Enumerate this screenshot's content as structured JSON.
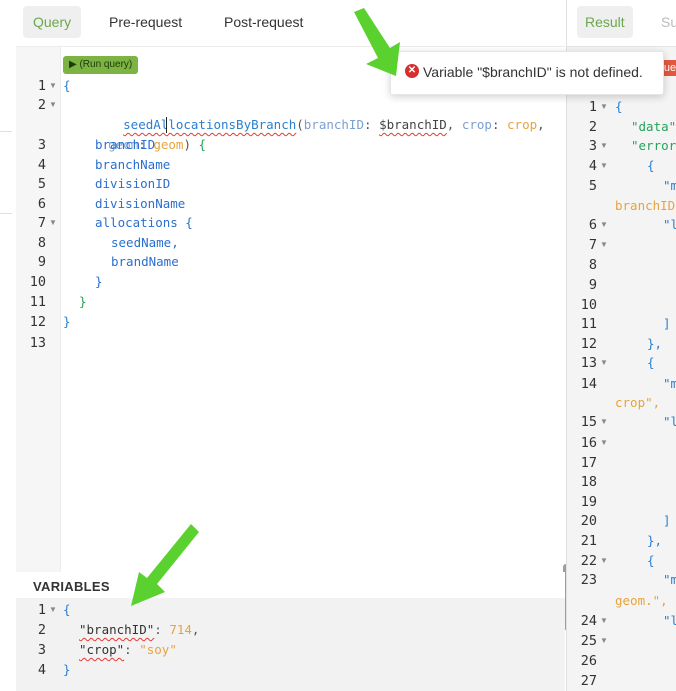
{
  "query_tabs": [
    "Query",
    "Pre-request",
    "Post-request"
  ],
  "run_button": "▶ (Run query)",
  "query_editor": {
    "line_numbers": [
      "1",
      "2",
      "3",
      "4",
      "5",
      "6",
      "7",
      "8",
      "9",
      "10",
      "11",
      "12",
      "13"
    ],
    "lines": [
      "{",
      "seedAllocationsByBranch(branchID: $branchID, crop: crop,",
      "geom: geom) {",
      "branchID",
      "branchName",
      "divisionID",
      "divisionName",
      "allocations {",
      "seedName,",
      "brandName",
      "}",
      "}",
      "}"
    ]
  },
  "variables": {
    "title": "VARIABLES",
    "line_numbers": [
      "1",
      "2",
      "3",
      "4"
    ],
    "open_brace": "{",
    "branch_key": "\"branchID\"",
    "branch_value": "714",
    "crop_key": "\"crop\"",
    "crop_value": "\"soy\"",
    "close_brace": "}"
  },
  "result": {
    "tab_label": "Result",
    "tab2_label": "Su",
    "error_badge": "ue",
    "line_numbers": [
      "1",
      "2",
      "3",
      "4",
      "5",
      "6",
      "7",
      "8",
      "9",
      "10",
      "11",
      "12",
      "13",
      "14",
      "15",
      "16",
      "17",
      "18",
      "19",
      "20",
      "21",
      "22",
      "23",
      "24",
      "25",
      "26",
      "27"
    ],
    "lines": {
      "1": "{",
      "2": "\"data\"",
      "3": "\"error",
      "4": "{",
      "5": "\"m",
      "5b": "branchID",
      "6": "\"l",
      "11": "]",
      "12": "},",
      "13": "{",
      "14": "\"m",
      "14b": "crop\",",
      "15": "\"l",
      "20": "]",
      "21": "},",
      "22": "{",
      "23": "\"m",
      "23b": "geom.\",",
      "24": "\"l"
    }
  },
  "error_tooltip": {
    "message": "Variable \"$branchID\" is not defined."
  },
  "colors": {
    "accent_green": "#6aa84f",
    "run_green": "#7cb342",
    "error_red": "#d62f2f",
    "arrow_green": "#5ad12e"
  }
}
